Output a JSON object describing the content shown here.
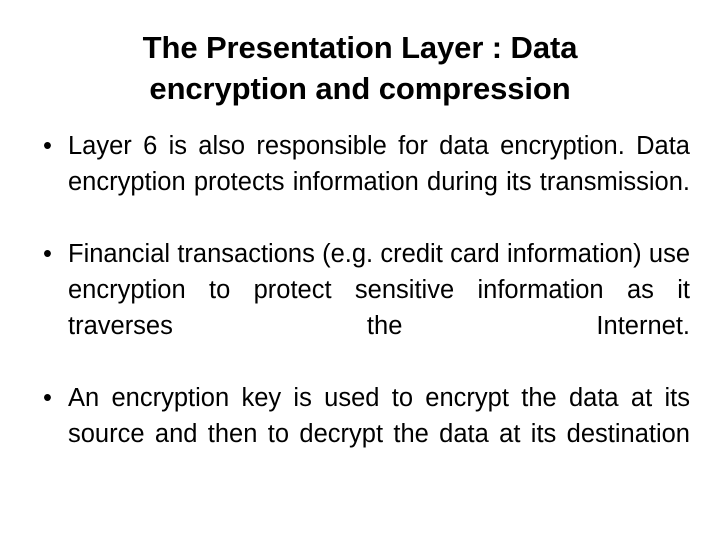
{
  "slide": {
    "background_color": "#ffffff",
    "text_color": "#000000",
    "title": "The Presentation Layer : Data encryption and compression",
    "title_line_1": "The Presentation Layer : Data",
    "title_line_2": "encryption and compression",
    "bullet_marker": "•",
    "bullets": [
      {
        "text": "Layer 6 is also responsible for data encryption. Data encryption protects information during its transmission.",
        "lines": [
          "Layer 6 is also responsible for data encryption.",
          "Data encryption protects information during its",
          "transmission."
        ]
      },
      {
        "text": "Financial transactions (e.g. credit card information) use encryption to protect sensitive information as it traverses the Internet.",
        "lines": [
          "Financial transactions (e.g. credit card",
          "information) use encryption to protect sensitive",
          "information as it traverses the Internet."
        ]
      },
      {
        "text": "An encryption key is used to encrypt the data at its source and then to decrypt the data at its destination",
        "lines": [
          "An encryption key is used to encrypt the data at",
          "its source and then to decrypt the data at its",
          "destination"
        ]
      }
    ]
  }
}
